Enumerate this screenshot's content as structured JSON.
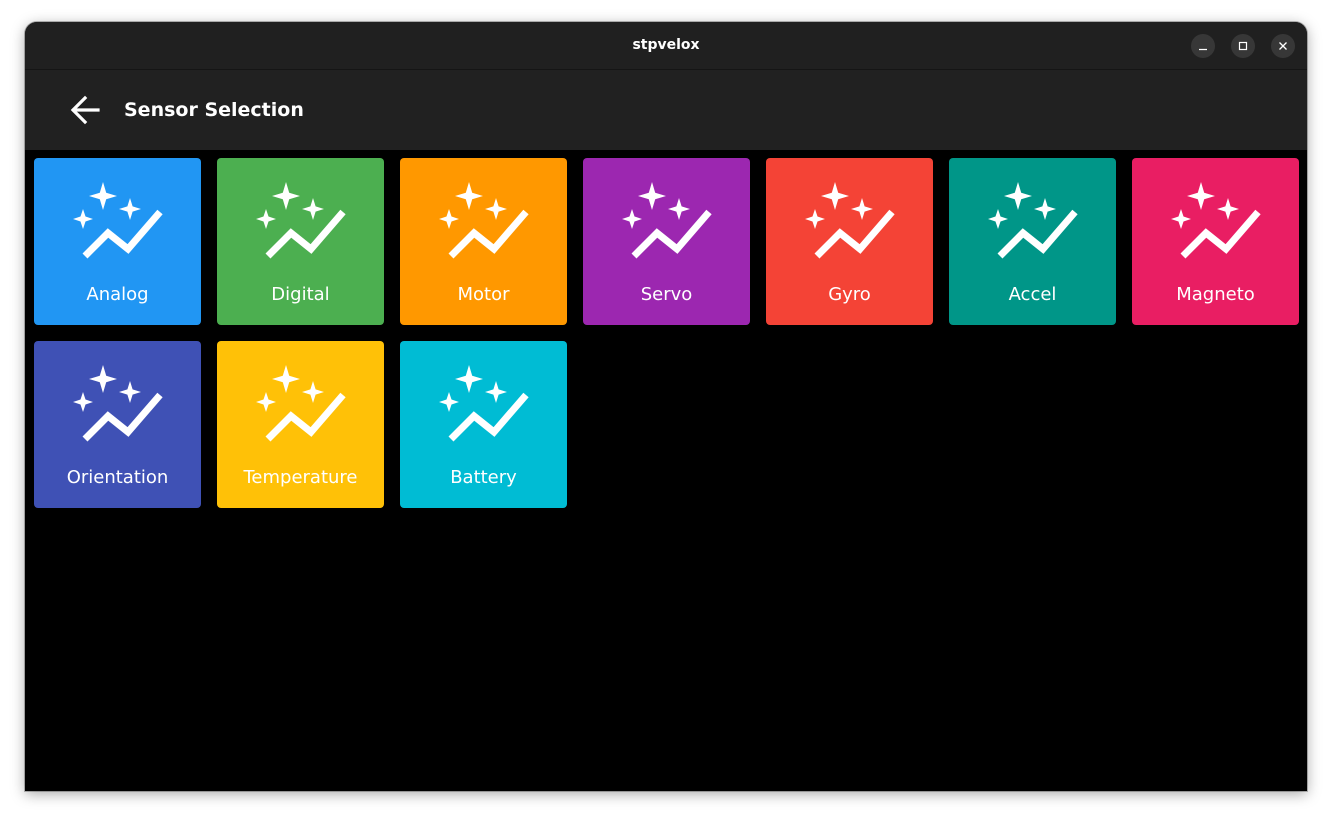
{
  "window": {
    "title": "stpvelox",
    "controls": {
      "minimize_icon": "minimize-icon",
      "maximize_icon": "maximize-icon",
      "close_icon": "close-icon"
    }
  },
  "appbar": {
    "back_icon": "arrow-back-icon",
    "title": "Sensor Selection"
  },
  "tiles": [
    {
      "label": "Analog",
      "color": "#2196F3",
      "icon": "auto-graph-icon"
    },
    {
      "label": "Digital",
      "color": "#4CAF50",
      "icon": "auto-graph-icon"
    },
    {
      "label": "Motor",
      "color": "#FF9800",
      "icon": "auto-graph-icon"
    },
    {
      "label": "Servo",
      "color": "#9C27B0",
      "icon": "auto-graph-icon"
    },
    {
      "label": "Gyro",
      "color": "#F44336",
      "icon": "auto-graph-icon"
    },
    {
      "label": "Accel",
      "color": "#009688",
      "icon": "auto-graph-icon"
    },
    {
      "label": "Magneto",
      "color": "#E91E63",
      "icon": "auto-graph-icon"
    },
    {
      "label": "Orientation",
      "color": "#3F51B5",
      "icon": "auto-graph-icon"
    },
    {
      "label": "Temperature",
      "color": "#FFC107",
      "icon": "auto-graph-icon"
    },
    {
      "label": "Battery",
      "color": "#00BCD4",
      "icon": "auto-graph-icon"
    }
  ]
}
